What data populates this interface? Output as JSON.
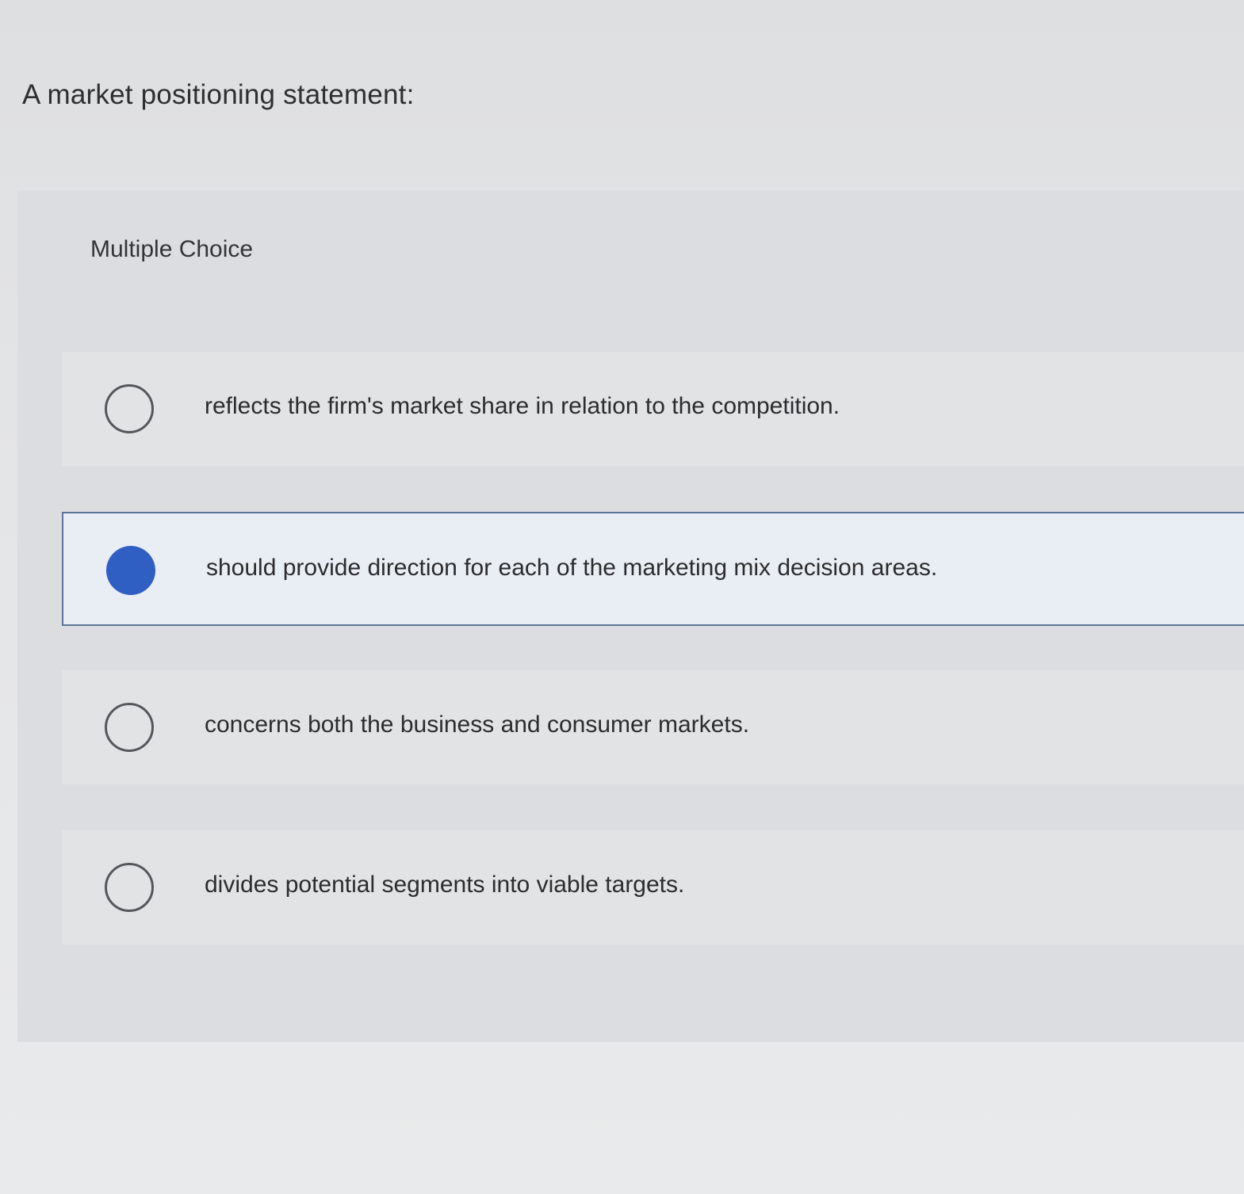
{
  "question": {
    "prompt": "A market positioning statement:",
    "type_label": "Multiple Choice"
  },
  "options": [
    {
      "label": "reflects the firm's market share in relation to the competition.",
      "selected": false
    },
    {
      "label": "should provide direction for each of the marketing mix decision areas.",
      "selected": true
    },
    {
      "label": "concerns both the business and consumer markets.",
      "selected": false
    },
    {
      "label": "divides potential segments into viable targets.",
      "selected": false
    }
  ],
  "colors": {
    "selected_radio": "#2f5fc2",
    "selected_border": "#5b7497",
    "selected_background": "#e9eef4"
  }
}
